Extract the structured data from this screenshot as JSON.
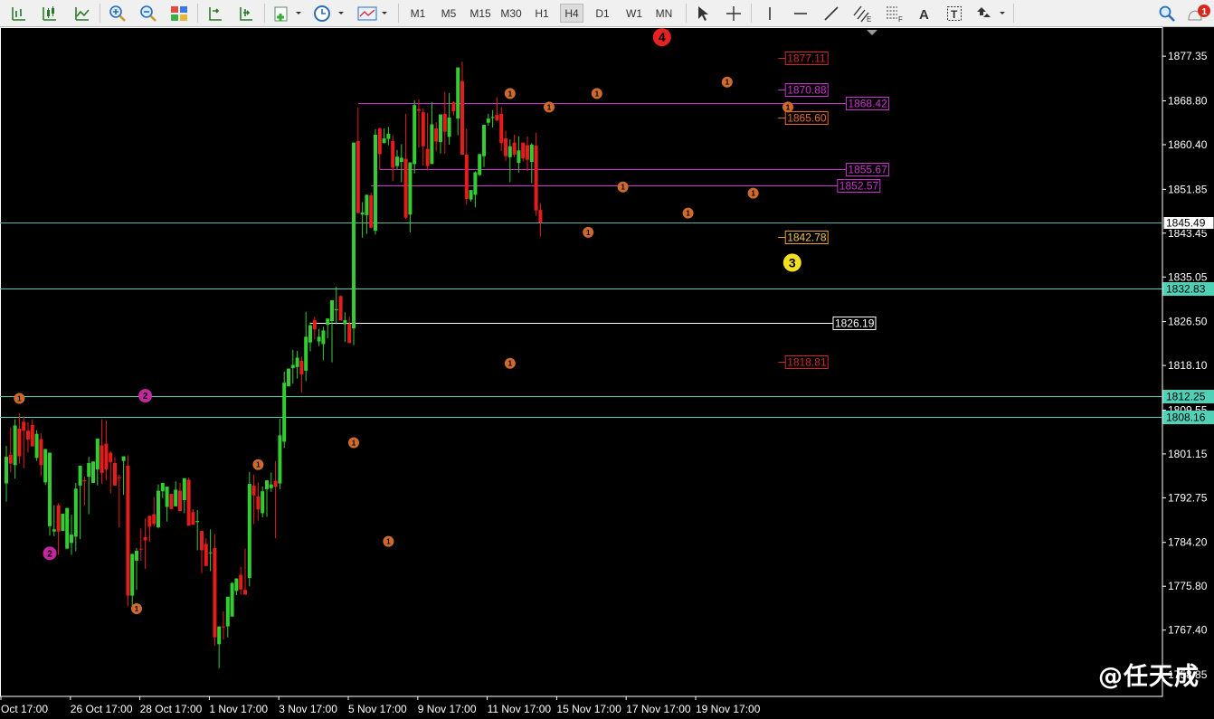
{
  "toolbar": {
    "timeframes": [
      "M1",
      "M5",
      "M15",
      "M30",
      "H1",
      "H4",
      "D1",
      "W1",
      "MN"
    ],
    "active_timeframe": "H4",
    "notification_count": "1"
  },
  "watermark": "@任天成",
  "chart_data": {
    "type": "candlestick",
    "price_axis": {
      "ticks": [
        "1877.35",
        "1868.80",
        "1860.40",
        "1851.85",
        "1843.45",
        "1835.05",
        "1826.50",
        "1818.10",
        "1809.55",
        "1801.15",
        "1792.75",
        "1784.20",
        "1775.80",
        "1767.40",
        "1758.85"
      ],
      "tick_values": [
        1877.35,
        1868.8,
        1860.4,
        1851.85,
        1843.45,
        1835.05,
        1826.5,
        1818.1,
        1809.55,
        1801.15,
        1792.75,
        1784.2,
        1775.8,
        1767.4,
        1758.85
      ],
      "range": [
        1754.7,
        1882.4
      ]
    },
    "time_axis": {
      "labels": [
        "Oct 17:00",
        "26 Oct 17:00",
        "28 Oct 17:00",
        "1 Nov 17:00",
        "3 Nov 17:00",
        "5 Nov 17:00",
        "9 Nov 17:00",
        "11 Nov 17:00",
        "15 Nov 17:00",
        "17 Nov 17:00",
        "19 Nov 17:00"
      ],
      "label_bars": [
        0,
        16,
        32,
        48,
        64,
        80,
        96,
        112,
        128,
        144,
        160
      ]
    },
    "candles": [
      [
        1795.5,
        1802.7,
        1792.0,
        1800.6
      ],
      [
        1801.0,
        1806.2,
        1797.6,
        1799.3
      ],
      [
        1799.0,
        1807.8,
        1796.4,
        1806.6
      ],
      [
        1806.0,
        1808.9,
        1799.3,
        1800.7
      ],
      [
        1807.3,
        1808.3,
        1798.4,
        1805.6
      ],
      [
        1805.6,
        1807.2,
        1801.4,
        1803.9
      ],
      [
        1806.7,
        1807.8,
        1802.7,
        1802.6
      ],
      [
        1800.4,
        1805.7,
        1799.8,
        1805.0
      ],
      [
        1804.0,
        1805.1,
        1797.0,
        1799.0
      ],
      [
        1795.7,
        1801.3,
        1795.2,
        1802.1
      ],
      [
        1787.3,
        1787.4,
        1785.5,
        1801.4
      ],
      [
        1786.3,
        1791.3,
        1785.4,
        1786.7
      ],
      [
        1791.3,
        1791.7,
        1781.8,
        1786.3
      ],
      [
        1786.4,
        1788.6,
        1786.4,
        1789.7
      ],
      [
        1783.0,
        1790.4,
        1783.0,
        1790.8
      ],
      [
        1784.1,
        1789.5,
        1781.8,
        1785.7
      ],
      [
        1785.3,
        1795.6,
        1782.5,
        1794.5
      ],
      [
        1795.1,
        1795.0,
        1784.8,
        1798.9
      ],
      [
        1796.1,
        1796.8,
        1791.3,
        1795.9
      ],
      [
        1796.8,
        1800.6,
        1789.6,
        1799.4
      ],
      [
        1795.6,
        1798.8,
        1798.1,
        1799.7
      ],
      [
        1798.2,
        1798.8,
        1795.1,
        1804.1
      ],
      [
        1802.8,
        1807.8,
        1795.4,
        1797.5
      ],
      [
        1803.1,
        1807.5,
        1796.1,
        1798.2
      ],
      [
        1801.4,
        1801.7,
        1793.6,
        1799.6
      ],
      [
        1799.4,
        1800.6,
        1796.4,
        1795.1
      ],
      [
        1796.7,
        1797.2,
        1787.1,
        1796.5
      ],
      [
        1799.8,
        1799.3,
        1793.3,
        1800.7
      ],
      [
        1798.9,
        1800.9,
        1772.0,
        1774.0
      ],
      [
        1774.0,
        1774.9,
        1771.0,
        1782.0
      ],
      [
        1780.7,
        1783.1,
        1775.1,
        1782.6
      ],
      [
        1783.0,
        1786.9,
        1780.7,
        1782.9
      ],
      [
        1785.2,
        1788.8,
        1779.1,
        1784.6
      ],
      [
        1789.3,
        1789.1,
        1784.3,
        1787.2
      ],
      [
        1789.6,
        1792.9,
        1787.2,
        1787.7
      ],
      [
        1787.1,
        1795.3,
        1786.9,
        1794.1
      ],
      [
        1794.0,
        1795.2,
        1792.7,
        1795.6
      ],
      [
        1791.0,
        1794.7,
        1788.2,
        1794.9
      ],
      [
        1793.5,
        1792.9,
        1792.3,
        1790.6
      ],
      [
        1791.1,
        1795.9,
        1793.1,
        1794.3
      ],
      [
        1794.1,
        1795.6,
        1790.2,
        1790.2
      ],
      [
        1792.3,
        1794.1,
        1789.8,
        1796.5
      ],
      [
        1796.2,
        1796.6,
        1794.0,
        1787.4
      ],
      [
        1790.0,
        1790.6,
        1788.1,
        1787.6
      ],
      [
        1788.1,
        1790.4,
        1782.7,
        1788.3
      ],
      [
        1786.4,
        1786.1,
        1778.3,
        1782.7
      ],
      [
        1783.9,
        1785.0,
        1781.8,
        1779.7
      ],
      [
        1782.2,
        1786.7,
        1778.7,
        1782.3
      ],
      [
        1783.1,
        1785.8,
        1764.4,
        1766.0
      ],
      [
        1764.7,
        1766.6,
        1760.1,
        1768.1
      ],
      [
        1768.1,
        1771.0,
        1765.6,
        1768.0
      ],
      [
        1768.1,
        1771.0,
        1766.0,
        1773.8
      ],
      [
        1770.0,
        1776.6,
        1770.3,
        1776.4
      ],
      [
        1774.9,
        1775.3,
        1774.1,
        1777.3
      ],
      [
        1778.0,
        1779.5,
        1774.2,
        1775.2
      ],
      [
        1775.1,
        1783.0,
        1774.3,
        1774.2
      ],
      [
        1777.4,
        1797.7,
        1775.8,
        1795.4
      ],
      [
        1795.1,
        1797.2,
        1787.7,
        1793.2
      ],
      [
        1793.0,
        1795.7,
        1788.4,
        1790.5
      ],
      [
        1789.8,
        1794.9,
        1789.0,
        1794.0
      ],
      [
        1794.4,
        1795.1,
        1789.1,
        1796.1
      ],
      [
        1794.6,
        1797.6,
        1793.9,
        1795.3
      ],
      [
        1796.0,
        1799.8,
        1785.0,
        1794.9
      ],
      [
        1795.5,
        1807.9,
        1794.4,
        1804.7
      ],
      [
        1803.5,
        1816.9,
        1802.3,
        1814.8
      ],
      [
        1814.1,
        1816.4,
        1815.3,
        1817.5
      ],
      [
        1817.6,
        1821.1,
        1814.6,
        1818.2
      ],
      [
        1817.8,
        1820.9,
        1815.6,
        1819.6
      ],
      [
        1819.0,
        1819.8,
        1812.9,
        1816.4
      ],
      [
        1817.1,
        1828.4,
        1815.1,
        1823.6
      ],
      [
        1822.5,
        1826.4,
        1820.8,
        1825.8
      ],
      [
        1826.8,
        1827.4,
        1823.1,
        1825.0
      ],
      [
        1822.7,
        1825.1,
        1821.8,
        1823.6
      ],
      [
        1822.2,
        1825.5,
        1819.1,
        1824.8
      ],
      [
        1825.9,
        1826.9,
        1823.3,
        1827.1
      ],
      [
        1826.6,
        1830.6,
        1818.7,
        1830.6
      ],
      [
        1828.7,
        1833.2,
        1826.0,
        1828.9
      ],
      [
        1831.4,
        1831.5,
        1830.6,
        1826.7
      ],
      [
        1826.0,
        1828.3,
        1822.6,
        1826.8
      ],
      [
        1826.1,
        1827.5,
        1824.6,
        1822.4
      ],
      [
        1825.2,
        1825.1,
        1822.0,
        1860.8
      ],
      [
        1861.1,
        1867.5,
        1858.9,
        1847.3
      ],
      [
        1847.0,
        1849.4,
        1842.6,
        1847.4
      ],
      [
        1846.9,
        1850.8,
        1843.3,
        1850.8
      ],
      [
        1850.7,
        1851.2,
        1844.4,
        1844.5
      ],
      [
        1843.9,
        1863.4,
        1843.2,
        1862.3
      ],
      [
        1863.5,
        1863.7,
        1855.6,
        1858.6
      ],
      [
        1860.7,
        1863.5,
        1861.1,
        1861.6
      ],
      [
        1861.5,
        1863.8,
        1860.3,
        1862.5
      ],
      [
        1861.1,
        1862.2,
        1853.4,
        1856.0
      ],
      [
        1856.3,
        1859.4,
        1855.7,
        1858.1
      ],
      [
        1857.1,
        1860.5,
        1853.2,
        1857.9
      ],
      [
        1857.7,
        1866.3,
        1846.1,
        1846.4
      ],
      [
        1847.0,
        1856.7,
        1843.6,
        1857.0
      ],
      [
        1856.7,
        1868.9,
        1854.9,
        1868.0
      ],
      [
        1867.2,
        1869.1,
        1859.8,
        1866.9
      ],
      [
        1866.6,
        1867.4,
        1856.4,
        1860.1
      ],
      [
        1859.6,
        1866.5,
        1855.5,
        1856.3
      ],
      [
        1856.7,
        1868.5,
        1857.5,
        1864.3
      ],
      [
        1863.5,
        1864.7,
        1859.1,
        1861.0
      ],
      [
        1860.9,
        1865.3,
        1858.7,
        1866.2
      ],
      [
        1866.3,
        1870.5,
        1858.7,
        1862.9
      ],
      [
        1861.9,
        1870.3,
        1860.4,
        1865.6
      ],
      [
        1868.5,
        1868.7,
        1866.0,
        1866.8
      ],
      [
        1865.4,
        1868.2,
        1862.2,
        1875.2
      ],
      [
        1872.6,
        1876.3,
        1859.9,
        1858.5
      ],
      [
        1858.5,
        1863.5,
        1848.9,
        1850.0
      ],
      [
        1849.9,
        1851.1,
        1849.5,
        1851.7
      ],
      [
        1850.8,
        1855.3,
        1848.4,
        1855.1
      ],
      [
        1854.6,
        1858.6,
        1854.4,
        1858.6
      ],
      [
        1858.2,
        1861.3,
        1856.1,
        1864.2
      ],
      [
        1864.6,
        1866.3,
        1864.0,
        1865.4
      ],
      [
        1865.7,
        1867.0,
        1863.7,
        1865.7
      ],
      [
        1866.1,
        1869.5,
        1865.8,
        1865.0
      ],
      [
        1866.3,
        1867.6,
        1859.2,
        1860.7
      ],
      [
        1861.6,
        1863.1,
        1857.3,
        1858.2
      ],
      [
        1858.0,
        1861.4,
        1853.2,
        1860.1
      ],
      [
        1860.8,
        1862.3,
        1858.0,
        1858.5
      ],
      [
        1856.9,
        1862.0,
        1855.1,
        1859.3
      ],
      [
        1860.8,
        1860.6,
        1857.2,
        1857.8
      ],
      [
        1860.3,
        1862.0,
        1855.3,
        1857.5
      ],
      [
        1857.1,
        1860.7,
        1853.0,
        1860.4
      ],
      [
        1860.2,
        1862.7,
        1846.8,
        1847.8
      ],
      [
        1847.9,
        1849.2,
        1842.8,
        1845.5
      ]
    ],
    "horizontal_lines": [
      {
        "price": 1845.49,
        "label": "1845.49",
        "color": "#4fb8a8",
        "style": "axis"
      },
      {
        "price": 1832.83,
        "label": "1832.83",
        "color": "#4fd1b8",
        "style": "axis"
      },
      {
        "price": 1812.25,
        "label": "1812.25",
        "color": "#4fd1b8",
        "style": "axis"
      },
      {
        "price": 1808.16,
        "label": "1808.16",
        "color": "#4fd1b8",
        "style": "axis"
      }
    ],
    "levels": [
      {
        "price": 1877.11,
        "label": "1877.11",
        "color": "#cc2a2a",
        "from_bar": null,
        "to_bar": 179
      },
      {
        "price": 1870.88,
        "label": "1870.88",
        "color": "#cc33cc",
        "from_bar": null,
        "to_bar": 179
      },
      {
        "price": 1868.42,
        "label": "1868.42",
        "color": "#cc33cc",
        "from_bar": 81,
        "to_bar": 193
      },
      {
        "price": 1865.6,
        "label": "1865.60",
        "color": "#e06a2a",
        "from_bar": null,
        "to_bar": 179
      },
      {
        "price": 1855.67,
        "label": "1855.67",
        "color": "#cc33cc",
        "from_bar": 86,
        "to_bar": 193
      },
      {
        "price": 1852.57,
        "label": "1852.57",
        "color": "#cc33cc",
        "from_bar": 84,
        "to_bar": 191
      },
      {
        "price": 1842.78,
        "label": "1842.78",
        "color": "#e8a52a",
        "from_bar": null,
        "to_bar": 179
      },
      {
        "price": 1826.19,
        "label": "1826.19",
        "color": "#ffffff",
        "from_bar": 70,
        "to_bar": 190
      },
      {
        "price": 1818.81,
        "label": "1818.81",
        "color": "#cc2a2a",
        "from_bar": null,
        "to_bar": 179
      }
    ],
    "markers": [
      {
        "bar": 3,
        "price": 1811.8,
        "label": "1",
        "color": "#cd6a30"
      },
      {
        "bar": 32,
        "price": 1812.3,
        "label": "2",
        "color": "#c4289e"
      },
      {
        "bar": 10,
        "price": 1782.1,
        "label": "2",
        "color": "#c4289e"
      },
      {
        "bar": 30,
        "price": 1771.5,
        "label": "1",
        "color": "#cd6a30"
      },
      {
        "bar": 58,
        "price": 1799.1,
        "label": "1",
        "color": "#cd6a30"
      },
      {
        "bar": 80,
        "price": 1803.3,
        "label": "1",
        "color": "#cd6a30"
      },
      {
        "bar": 88,
        "price": 1784.4,
        "label": "1",
        "color": "#cd6a30"
      },
      {
        "bar": 116,
        "price": 1818.5,
        "label": "1",
        "color": "#cd6a30"
      },
      {
        "bar": 116,
        "price": 1870.2,
        "label": "1",
        "color": "#cd6a30"
      },
      {
        "bar": 125,
        "price": 1867.6,
        "label": "1",
        "color": "#cd6a30"
      },
      {
        "bar": 136,
        "price": 1870.2,
        "label": "1",
        "color": "#cd6a30"
      },
      {
        "bar": 134,
        "price": 1843.6,
        "label": "1",
        "color": "#cd6a30"
      },
      {
        "bar": 142,
        "price": 1852.3,
        "label": "1",
        "color": "#cd6a30"
      },
      {
        "bar": 157,
        "price": 1847.3,
        "label": "1",
        "color": "#cd6a30"
      },
      {
        "bar": 166,
        "price": 1872.4,
        "label": "1",
        "color": "#cd6a30"
      },
      {
        "bar": 172,
        "price": 1851.1,
        "label": "1",
        "color": "#cd6a30"
      },
      {
        "bar": 180,
        "price": 1867.6,
        "label": "1",
        "color": "#cd6a30"
      },
      {
        "bar": 151,
        "price": 1881.0,
        "label": "4",
        "color": "#e52222"
      },
      {
        "bar": 181,
        "price": 1837.8,
        "label": "3",
        "color": "#f0e020"
      }
    ]
  }
}
